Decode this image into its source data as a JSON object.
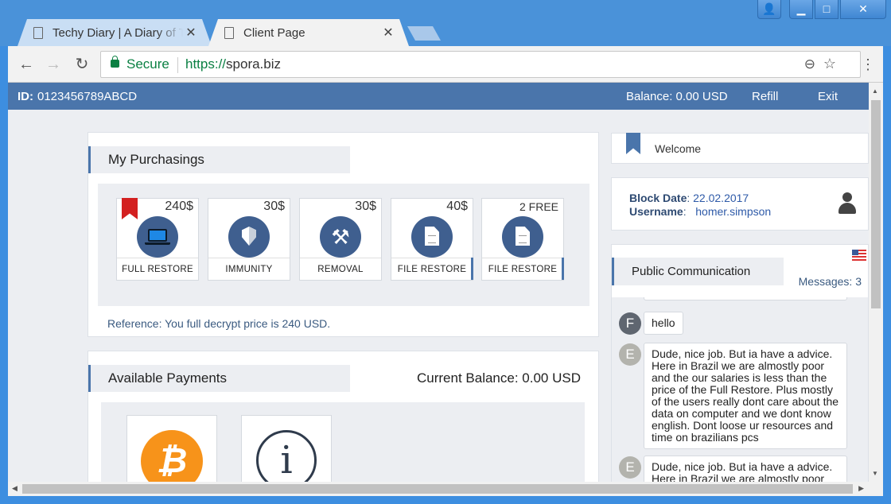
{
  "browser": {
    "tabs": [
      {
        "title": "Techy Diary | A Diary of T",
        "active": false
      },
      {
        "title": "Client Page",
        "active": true
      }
    ],
    "secure_label": "Secure",
    "url_scheme": "https://",
    "url_host": "spora.biz",
    "icons": {
      "back": "back-arrow-icon",
      "forward": "forward-arrow-icon",
      "reload": "reload-icon",
      "zoom": "zoom-out-icon",
      "star": "bookmark-star-icon",
      "menu": "kebab-menu-icon"
    }
  },
  "topbar": {
    "id_label": "ID:",
    "id_value": "0123456789ABCD",
    "balance": "Balance: 0.00 USD",
    "refill": "Refill",
    "exit": "Exit"
  },
  "purchasings": {
    "title": "My Purchasings",
    "products": [
      {
        "price": "240$",
        "label": "FULL RESTORE",
        "icon": "laptop-icon",
        "bookmarked": true
      },
      {
        "price": "30$",
        "label": "IMMUNITY",
        "icon": "shield-icon"
      },
      {
        "price": "30$",
        "label": "REMOVAL",
        "icon": "tools-icon"
      },
      {
        "price": "40$",
        "label": "FILE RESTORE",
        "icon": "file-icon"
      },
      {
        "price": "2 FREE",
        "label": "FILE RESTORE",
        "icon": "file-icon"
      }
    ],
    "reference": "Reference: You full decrypt price is 240 USD."
  },
  "payments": {
    "title": "Available Payments",
    "current_balance": "Current Balance: 0.00 USD",
    "btc_symbol": "₿",
    "info_symbol": "i"
  },
  "welcome": {
    "label": "Welcome"
  },
  "user": {
    "block_date_label": "Block Date",
    "block_date_value": "22.02.2017",
    "username_label": "Username",
    "username_value": "homer.simpson"
  },
  "communication": {
    "title": "Public Communication",
    "messages_count": "Messages: 3",
    "messages": [
      {
        "avatar": "F",
        "text": "hello"
      },
      {
        "avatar": "E",
        "text": "Dude, nice job. But ia have a advice. Here in Brazil we are almostly poor and the our salaries is less than the price of the Full Restore. Plus mostly of the users really dont care about the data on computer and we dont know english. Dont loose ur resources and time on brazilians pcs"
      },
      {
        "avatar": "E",
        "text": "Dude, nice job. But ia have a advice. Here in Brazil we are almostly poor"
      }
    ]
  },
  "colors": {
    "accent": "#4a75ab",
    "bitcoin": "#f7931a",
    "ribbon": "#d32020"
  }
}
